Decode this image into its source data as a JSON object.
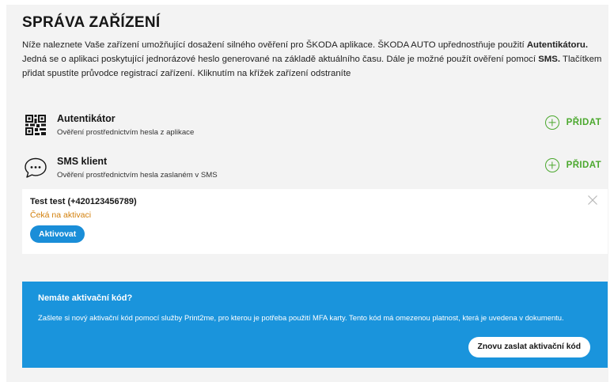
{
  "page": {
    "title": "SPRÁVA ZAŘÍZENÍ",
    "intro": [
      {
        "text": "Níže naleznete Vaše zařízení umožňující dosažení silného ověření pro ŠKODA aplikace. ŠKODA AUTO upřednostňuje použití ",
        "bold": false
      },
      {
        "text": "Autentikátoru.",
        "bold": true
      },
      {
        "text": " Jedná se o aplikaci poskytující jednorázové heslo generované na základě aktuálního času. Dále je možné použít ověření pomocí ",
        "bold": false
      },
      {
        "text": "SMS.",
        "bold": true
      },
      {
        "text": " Tlačítkem přidat spustíte průvodce registrací zařízení. Kliknutím na křížek zařízení odstraníte",
        "bold": false
      }
    ]
  },
  "methods": [
    {
      "title": "Autentikátor",
      "description": "Ověření prostřednictvím hesla z aplikace",
      "add_label": "PŘIDAT",
      "icon": "qr-code-icon"
    },
    {
      "title": "SMS klient",
      "description": "Ověření prostřednictvím hesla zaslaném v SMS",
      "add_label": "PŘIDAT",
      "icon": "chat-bubble-icon"
    }
  ],
  "device": {
    "name": "Test test (+420123456789)",
    "status": "Čeká na aktivaci",
    "activate_label": "Aktivovat"
  },
  "info": {
    "title": "Nemáte aktivační kód?",
    "text": "Zašlete si nový aktivační kód pomocí služby Print2me, pro kterou je potřeba použití MFA karty. Tento kód má omezenou platnost, která je uvedena v dokumentu.",
    "resend_label": "Znovu zaslat aktivační kód"
  },
  "colors": {
    "accent_green": "#4ba82e",
    "primary_blue": "#1a8ed8",
    "info_blue": "#1a94dc",
    "pending_orange": "#d27f0a",
    "panel_bg": "#f3f3f3"
  }
}
